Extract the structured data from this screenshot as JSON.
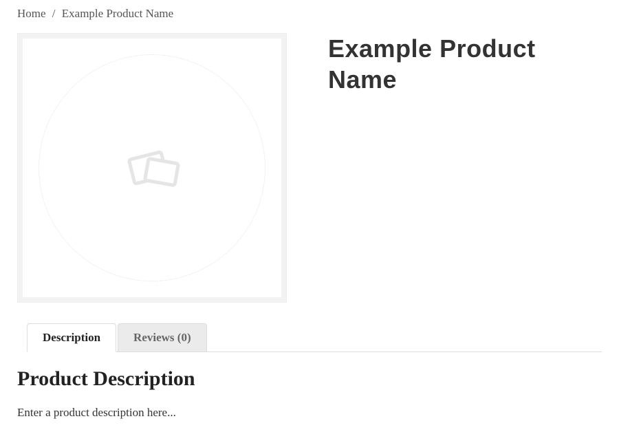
{
  "breadcrumb": {
    "home": "Home",
    "separator": "/",
    "product": "Example Product Name"
  },
  "product": {
    "title": "Example Product Name"
  },
  "tabs": {
    "description": "Description",
    "reviews": "Reviews (0)"
  },
  "description": {
    "heading": "Product Description",
    "text": "Enter a product description here..."
  }
}
